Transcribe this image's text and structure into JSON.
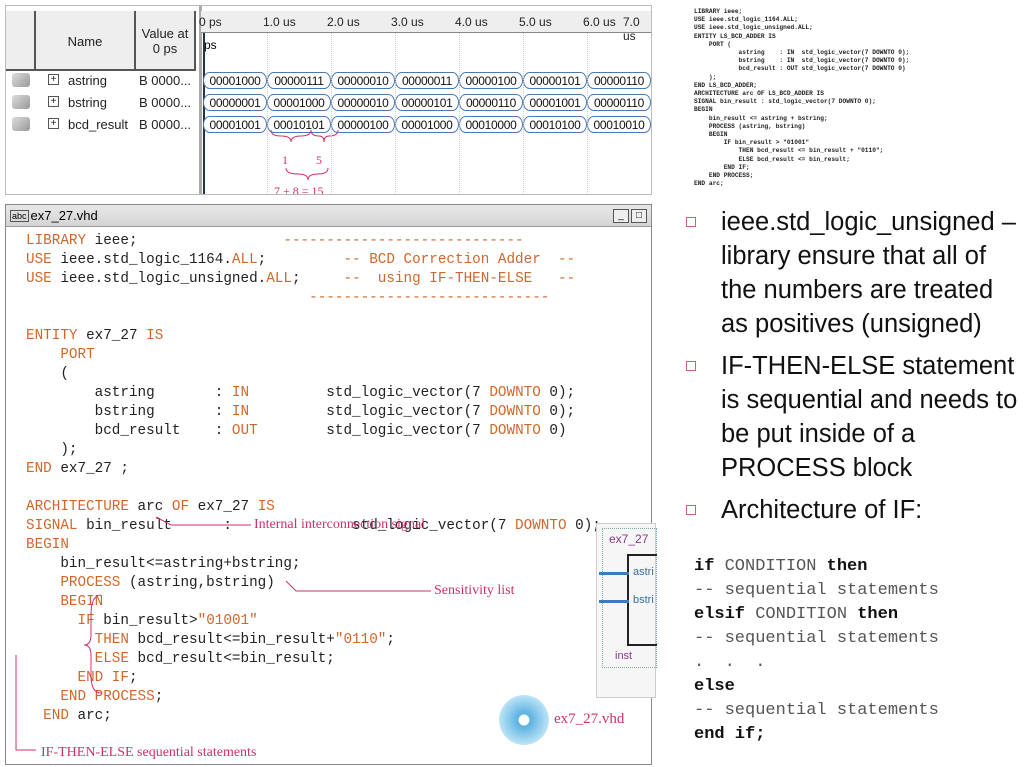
{
  "waveform": {
    "headers": {
      "name": "Name",
      "value": "Value at\n0 ps"
    },
    "time_labels": [
      "0 ps",
      "1.0 us",
      "2.0 us",
      "3.0 us",
      "4.0 us",
      "5.0 us",
      "6.0 us",
      "7.0 us"
    ],
    "cursor_label": "ps",
    "signals": [
      {
        "name": "astring",
        "value": "B 0000...",
        "values": [
          "00001000",
          "00000111",
          "00000010",
          "00000011",
          "00000100",
          "00000101",
          "00000110"
        ]
      },
      {
        "name": "bstring",
        "value": "B 0000...",
        "values": [
          "00000001",
          "00001000",
          "00000010",
          "00000101",
          "00000110",
          "00001001",
          "00000110"
        ]
      },
      {
        "name": "bcd_result",
        "value": "B 0000...",
        "values": [
          "00001001",
          "00010101",
          "00000100",
          "00001000",
          "00010000",
          "00010100",
          "00010010"
        ]
      }
    ],
    "annotations": {
      "digit1": "1",
      "digit2": "5",
      "sum": "7 + 8 = 15"
    }
  },
  "editor": {
    "title": "ex7_27.vhd",
    "file_icon_label": "abc",
    "lines": [
      [
        [
          "LIBRARY",
          "kw"
        ],
        [
          " ieee;",
          ""
        ],
        [
          "                 ----------------------------",
          "cm"
        ]
      ],
      [
        [
          "USE",
          "kw"
        ],
        [
          " ieee.std_logic_1164.",
          ""
        ],
        [
          "ALL",
          "kw"
        ],
        [
          ";         ",
          ""
        ],
        [
          "-- BCD Correction Adder  --",
          "cm"
        ]
      ],
      [
        [
          "USE",
          "kw"
        ],
        [
          " ieee.std_logic_unsigned.",
          ""
        ],
        [
          "ALL",
          "kw"
        ],
        [
          ";     ",
          ""
        ],
        [
          "--  using IF-THEN-ELSE   --",
          "cm"
        ]
      ],
      [
        [
          "                                 ----------------------------",
          "cm"
        ]
      ],
      [
        [
          "",
          ""
        ]
      ],
      [
        [
          "ENTITY",
          "kw"
        ],
        [
          " ex7_27 ",
          ""
        ],
        [
          "IS",
          "kw"
        ]
      ],
      [
        [
          "    ",
          ""
        ],
        [
          "PORT",
          "kw"
        ]
      ],
      [
        [
          "    (",
          ""
        ]
      ],
      [
        [
          "        astring       : ",
          ""
        ],
        [
          "IN",
          "kw"
        ],
        [
          "         std_logic_vector(7 ",
          ""
        ],
        [
          "DOWNTO",
          "kw"
        ],
        [
          " 0);",
          ""
        ]
      ],
      [
        [
          "        bstring       : ",
          ""
        ],
        [
          "IN",
          "kw"
        ],
        [
          "         std_logic_vector(7 ",
          ""
        ],
        [
          "DOWNTO",
          "kw"
        ],
        [
          " 0);",
          ""
        ]
      ],
      [
        [
          "        bcd_result    : ",
          ""
        ],
        [
          "OUT",
          "kw"
        ],
        [
          "        std_logic_vector(7 ",
          ""
        ],
        [
          "DOWNTO",
          "kw"
        ],
        [
          " 0)",
          ""
        ]
      ],
      [
        [
          "    );",
          ""
        ]
      ],
      [
        [
          "END",
          "kw"
        ],
        [
          " ex7_27 ;",
          ""
        ]
      ],
      [
        [
          "",
          ""
        ]
      ],
      [
        [
          "ARCHITECTURE",
          "kw"
        ],
        [
          " arc ",
          ""
        ],
        [
          "OF",
          "kw"
        ],
        [
          " ex7_27 ",
          ""
        ],
        [
          "IS",
          "kw"
        ]
      ],
      [
        [
          "SIGNAL",
          "kw"
        ],
        [
          " bin_result      :              std_logic_vector(7 ",
          ""
        ],
        [
          "DOWNTO",
          "kw"
        ],
        [
          " 0);",
          ""
        ]
      ],
      [
        [
          "BEGIN",
          "kw"
        ]
      ],
      [
        [
          "    bin_result<=astring+bstring;",
          ""
        ]
      ],
      [
        [
          "    ",
          ""
        ],
        [
          "PROCESS",
          "kw"
        ],
        [
          " (astring,bstring)",
          ""
        ]
      ],
      [
        [
          "    ",
          ""
        ],
        [
          "BEGIN",
          "kw"
        ]
      ],
      [
        [
          "      ",
          ""
        ],
        [
          "IF",
          "kw"
        ],
        [
          " bin_result>",
          ""
        ],
        [
          "\"01001\"",
          "str"
        ]
      ],
      [
        [
          "        ",
          ""
        ],
        [
          "THEN",
          "kw"
        ],
        [
          " bcd_result<=bin_result+",
          ""
        ],
        [
          "\"0110\"",
          "str"
        ],
        [
          ";",
          ""
        ]
      ],
      [
        [
          "        ",
          ""
        ],
        [
          "ELSE",
          "kw"
        ],
        [
          " bcd_result<=bin_result;",
          ""
        ]
      ],
      [
        [
          "      ",
          ""
        ],
        [
          "END IF",
          "kw"
        ],
        [
          ";",
          ""
        ]
      ],
      [
        [
          "    ",
          ""
        ],
        [
          "END PROCESS",
          "kw"
        ],
        [
          ";",
          ""
        ]
      ],
      [
        [
          "  ",
          ""
        ],
        [
          "END",
          "kw"
        ],
        [
          " arc;",
          ""
        ]
      ]
    ],
    "callouts": {
      "internal": "Internal interconnection signal",
      "sensitivity": "Sensitivity list",
      "ifthenelse": "IF-THEN-ELSE sequential statements",
      "file": "ex7_27.vhd"
    },
    "symbol": {
      "name": "ex7_27",
      "ports": [
        "astri",
        "bstri"
      ],
      "inst": "inst"
    }
  },
  "slide_code": "LIBRARY ieee;\nUSE ieee.std_logic_1164.ALL;\nUSE ieee.std_logic_unsigned.ALL;\nENTITY LS_BCD_ADDER IS\n    PORT (\n            astring    : IN  std_logic_vector(7 DOWNTO 0);\n            bstring    : IN  std_logic_vector(7 DOWNTO 0);\n            bcd_result : OUT std_logic_vector(7 DOWNTO 0)\n    );\nEND LS_BCD_ADDER;\nARCHITECTURE arc OF LS_BCD_ADDER IS\nSIGNAL bin_result : std_logic_vector(7 DOWNTO 0);\nBEGIN\n    bin_result <= astring + bstring;\n    PROCESS (astring, bstring)\n    BEGIN\n        IF bin_result > \"01001\"\n            THEN bcd_result <= bin_result + \"0110\";\n            ELSE bcd_result <= bin_result;\n        END IF;\n    END PROCESS;\nEND arc;",
  "bullets": [
    "ieee.std_logic_unsigned – library ensure that all of the numbers are treated as positives (unsigned)",
    "IF-THEN-ELSE statement is sequential and needs to be put inside of a PROCESS block",
    "Architecture of IF:"
  ],
  "if_syntax": [
    [
      [
        "if",
        "b"
      ],
      [
        " CONDITION ",
        ""
      ],
      [
        "then",
        "b"
      ]
    ],
    [
      [
        "-- sequential statements",
        ""
      ]
    ],
    [
      [
        "elsif",
        "b"
      ],
      [
        " CONDITION ",
        ""
      ],
      [
        "then",
        "b"
      ]
    ],
    [
      [
        "-- sequential statements",
        ""
      ]
    ],
    [
      [
        ".  .  .",
        ""
      ]
    ],
    [
      [
        "else",
        "b"
      ]
    ],
    [
      [
        "-- sequential statements",
        ""
      ]
    ],
    [
      [
        "end if;",
        "b"
      ]
    ]
  ]
}
